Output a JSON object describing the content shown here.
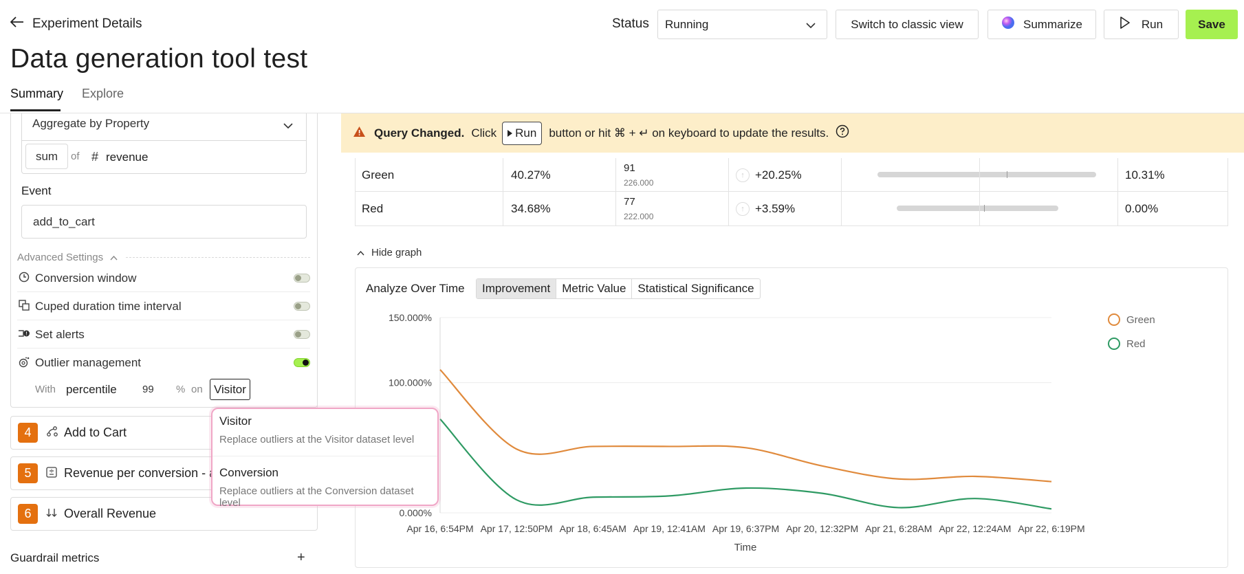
{
  "header": {
    "back_label": "Experiment Details",
    "title": "Data generation tool test",
    "tabs": [
      "Summary",
      "Explore"
    ],
    "status_label": "Status",
    "status_value": "Running",
    "classic_label": "Switch to classic view",
    "summarize_label": "Summarize",
    "run_label": "Run",
    "save_label": "Save"
  },
  "left": {
    "aggregate_value": "Aggregate by Property",
    "agg_fn": "sum",
    "of_label": "of",
    "property": "revenue",
    "event_label": "Event",
    "event_value": "add_to_cart",
    "advanced_label": "Advanced Settings",
    "advanced": [
      {
        "label": "Conversion window",
        "on": false
      },
      {
        "label": "Cuped duration time interval",
        "on": false
      },
      {
        "label": "Set alerts",
        "on": false
      },
      {
        "label": "Outlier management",
        "on": true
      }
    ],
    "outlier": {
      "with_label": "With",
      "method": "percentile",
      "value": "99",
      "pct_label": "%",
      "on_label": "on",
      "level": "Visitor"
    },
    "metrics": [
      {
        "num": "4",
        "label": "Add to Cart"
      },
      {
        "num": "5",
        "label": "Revenue per conversion - ad"
      },
      {
        "num": "6",
        "label": "Overall Revenue"
      }
    ],
    "guardrail_label": "Guardrail metrics",
    "guardrail_add": "+"
  },
  "dropdown": {
    "options": [
      {
        "title": "Visitor",
        "desc": "Replace outliers at the Visitor dataset level"
      },
      {
        "title": "Conversion",
        "desc": "Replace outliers at the Conversion dataset level"
      }
    ]
  },
  "banner": {
    "bold": "Query Changed.",
    "pre": "Click",
    "run": "Run",
    "post": "button or hit ⌘ + ↵ on keyboard to update the results."
  },
  "table": {
    "rows": [
      {
        "name": "Green",
        "rate": "40.27%",
        "count": "91",
        "total": "226.000",
        "improvement": "+20.25%",
        "ci_lo": 0.124,
        "ci_hi": 0.88,
        "significance": "10.31%"
      },
      {
        "name": "Red",
        "rate": "34.68%",
        "count": "77",
        "total": "222.000",
        "improvement": "+3.59%",
        "ci_lo": 0.19,
        "ci_hi": 0.75,
        "significance": "0.00%"
      }
    ]
  },
  "graph": {
    "hide_label": "Hide graph",
    "title": "Analyze Over Time",
    "modes": [
      "Improvement",
      "Metric Value",
      "Statistical Significance"
    ],
    "active_mode": "Improvement"
  },
  "chart_data": {
    "type": "line",
    "xlabel": "Time",
    "ylabel": "",
    "x": [
      "Apr 16, 6:54PM",
      "Apr 17, 12:50PM",
      "Apr 18, 6:45AM",
      "Apr 19, 12:41AM",
      "Apr 19, 6:37PM",
      "Apr 20, 12:32PM",
      "Apr 21, 6:28AM",
      "Apr 22, 12:24AM",
      "Apr 22, 6:19PM"
    ],
    "y_ticks": [
      "150.000%",
      "100.000%",
      "0.000%"
    ],
    "ylim": [
      0,
      150
    ],
    "legend_position": "top-right",
    "series": [
      {
        "name": "Green",
        "color": "#e08a3c",
        "values": [
          110,
          49,
          51,
          51,
          50,
          36,
          26,
          28,
          24
        ]
      },
      {
        "name": "Red",
        "color": "#2e9a63",
        "values": [
          72,
          10,
          12,
          13,
          19,
          15,
          4,
          11,
          3
        ]
      }
    ]
  }
}
